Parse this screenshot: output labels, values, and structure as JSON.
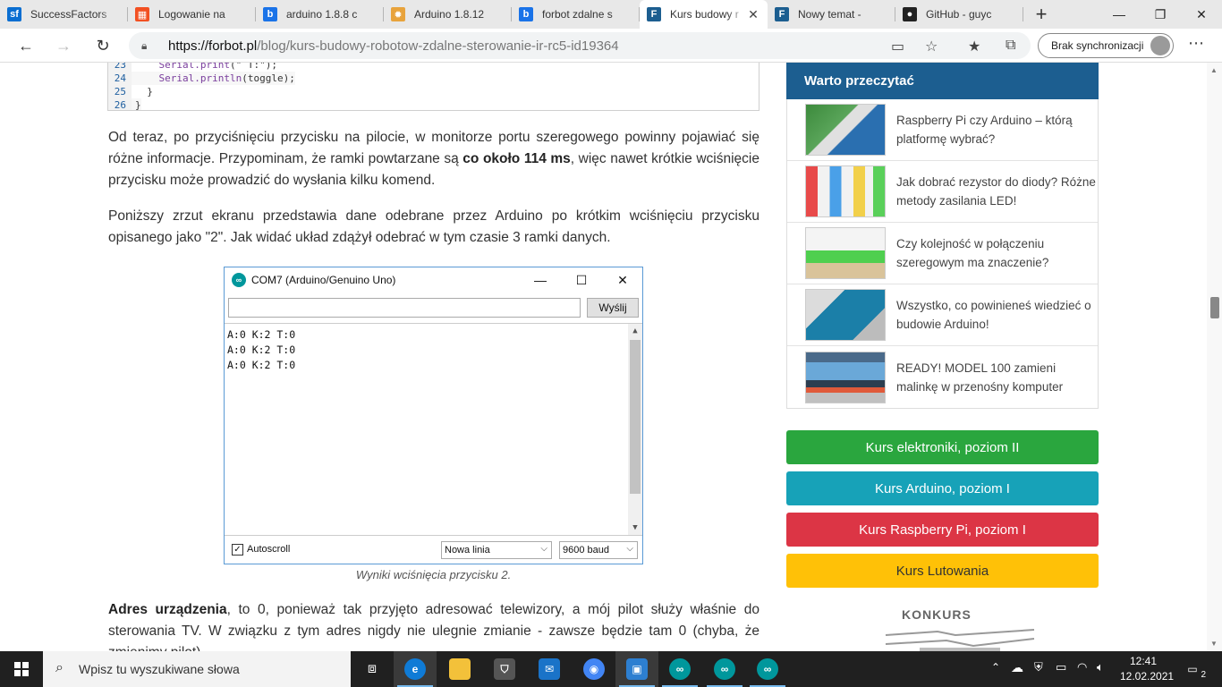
{
  "browser": {
    "tabs": [
      {
        "label": "SuccessFactors",
        "icon": "successfactors-icon",
        "color": "#0a6ed1",
        "glyph": "sf"
      },
      {
        "label": "Logowanie na",
        "icon": "microsoft-icon",
        "color": "#f25022",
        "glyph": "▦"
      },
      {
        "label": "arduino 1.8.8 c",
        "icon": "bing-icon",
        "color": "#1a73e8",
        "glyph": "b"
      },
      {
        "label": "Arduino 1.8.12",
        "icon": "gear-favicon-icon",
        "color": "#e8a33c",
        "glyph": "✹"
      },
      {
        "label": "forbot zdalne s",
        "icon": "bing-icon",
        "color": "#1a73e8",
        "glyph": "b"
      },
      {
        "label": "Kurs budowy r",
        "icon": "forbot-icon",
        "color": "#1c5e90",
        "glyph": "F",
        "active": true
      },
      {
        "label": "Nowy temat -",
        "icon": "forbot-icon",
        "color": "#1c5e90",
        "glyph": "F"
      },
      {
        "label": "GitHub - guyc",
        "icon": "github-icon",
        "color": "#222222",
        "glyph": "●"
      }
    ],
    "url_host": "https://forbot.pl",
    "url_path": "/blog/kurs-budowy-robotow-zdalne-sterowanie-ir-rc5-id19364",
    "sync_label": "Brak synchronizacji"
  },
  "code": {
    "lines": [
      {
        "num": "23",
        "text": "    Serial.print(\" T:\");"
      },
      {
        "num": "24",
        "text": "    Serial.println(toggle);"
      },
      {
        "num": "25",
        "text": "  }"
      },
      {
        "num": "26",
        "text": "}"
      }
    ]
  },
  "article": {
    "p1_a": "Od teraz, po przyciśnięciu przycisku na pilocie, w monitorze portu szeregowego powinny pojawiać się różne informacje. Przypominam, że ramki powtarzane są ",
    "p1_bold": "co około 114 ms",
    "p1_b": ", więc nawet krótkie wciśnięcie przycisku może prowadzić do wysłania kilku komend.",
    "p2": "Poniższy zrzut ekranu przedstawia dane odebrane przez Arduino po krótkim wciśnięciu przycisku opisanego jako \"2\". Jak widać układ zdążył odebrać w tym czasie 3 ramki danych.",
    "caption": "Wyniki wciśnięcia przycisku 2.",
    "p3_bold": "Adres urządzenia",
    "p3": ", to 0, ponieważ tak przyjęto adresować telewizory, a mój pilot służy właśnie do sterowania TV. W związku z tym adres nigdy nie ulegnie zmianie - zawsze będzie tam 0 (chyba, że zmienimy pilot)."
  },
  "serial_monitor": {
    "title": "COM7 (Arduino/Genuino Uno)",
    "send_label": "Wyślij",
    "output": [
      "A:0 K:2 T:0",
      "A:0 K:2 T:0",
      "A:0 K:2 T:0"
    ],
    "autoscroll_label": "Autoscroll",
    "autoscroll_checked": true,
    "line_ending": "Nowa linia",
    "baud": "9600 baud"
  },
  "sidebar": {
    "header": "Warto przeczytać",
    "items": [
      {
        "text": "Raspberry Pi czy Arduino – którą platformę wybrać?"
      },
      {
        "text": "Jak dobrać rezystor do diody? Różne metody zasilania LED!"
      },
      {
        "text": "Czy kolejność w połączeniu szeregowym ma znaczenie?"
      },
      {
        "text": "Wszystko, co powinieneś wiedzieć o budowie Arduino!"
      },
      {
        "text": "READY! MODEL 100 zamieni malinkę w przenośny komputer"
      }
    ],
    "courses": [
      {
        "label": "Kurs elektroniki, poziom II",
        "color": "#2aa63e"
      },
      {
        "label": "Kurs Arduino, poziom I",
        "color": "#17a2b8"
      },
      {
        "label": "Kurs Raspberry Pi, poziom I",
        "color": "#dc3545"
      },
      {
        "label": "Kurs Lutowania",
        "color": "#ffc107",
        "text_color": "#333333"
      }
    ],
    "konkurs": "KONKURS"
  },
  "taskbar": {
    "search_placeholder": "Wpisz tu wyszukiwane słowa",
    "time": "12:41",
    "date": "12.02.2021",
    "notifications": "2"
  }
}
